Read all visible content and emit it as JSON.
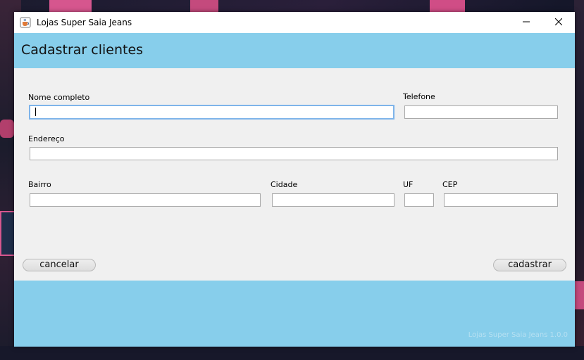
{
  "window": {
    "title": "Lojas Super Saia Jeans",
    "icons": {
      "app": "java-cup-icon",
      "minimize": "minimize-icon",
      "close": "close-icon"
    }
  },
  "header": {
    "title": "Cadastrar clientes"
  },
  "form": {
    "nome": {
      "label": "Nome completo",
      "value": ""
    },
    "telefone": {
      "label": "Telefone",
      "value": ""
    },
    "endereco": {
      "label": "Endereço",
      "value": ""
    },
    "bairro": {
      "label": "Bairro",
      "value": ""
    },
    "cidade": {
      "label": "Cidade",
      "value": ""
    },
    "uf": {
      "label": "UF",
      "value": ""
    },
    "cep": {
      "label": "CEP",
      "value": ""
    }
  },
  "actions": {
    "cancel_label": "cancelar",
    "submit_label": "cadastrar"
  },
  "footer": {
    "version": "Lojas Super Saia Jeans 1.0.0"
  },
  "colors": {
    "header_band": "#87ceeb",
    "form_background": "#f0f0f0",
    "focus_border": "#7eb4ea"
  }
}
